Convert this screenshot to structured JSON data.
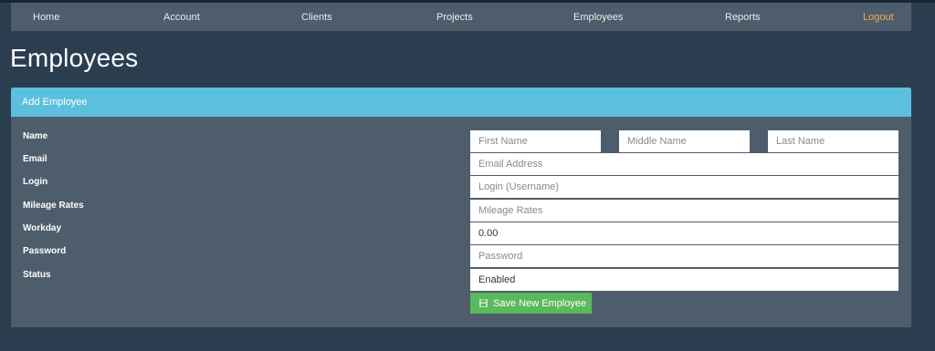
{
  "nav": {
    "home": "Home",
    "account": "Account",
    "clients": "Clients",
    "projects": "Projects",
    "employees": "Employees",
    "reports": "Reports",
    "logout": "Logout"
  },
  "page": {
    "title": "Employees"
  },
  "panel": {
    "heading": "Add Employee"
  },
  "form": {
    "labels": {
      "name": "Name",
      "email": "Email",
      "login": "Login",
      "mileage": "Mileage Rates",
      "workday": "Workday",
      "password": "Password",
      "status": "Status"
    },
    "placeholders": {
      "first_name": "First Name",
      "middle_name": "Middle Name",
      "last_name": "Last Name",
      "email": "Email Address",
      "login": "Login (Username)",
      "mileage": "Mileage Rates",
      "password": "Password"
    },
    "values": {
      "workday": "0.00",
      "status": "Enabled"
    },
    "save_label": "Save New Employee"
  },
  "colors": {
    "background": "#2b3e50",
    "navbar": "#4e5d6c",
    "panel_heading": "#5bc0de",
    "save_button": "#5cb85c",
    "logout": "#f0ad4e"
  },
  "icons": {
    "save": "floppy-disk-icon"
  }
}
